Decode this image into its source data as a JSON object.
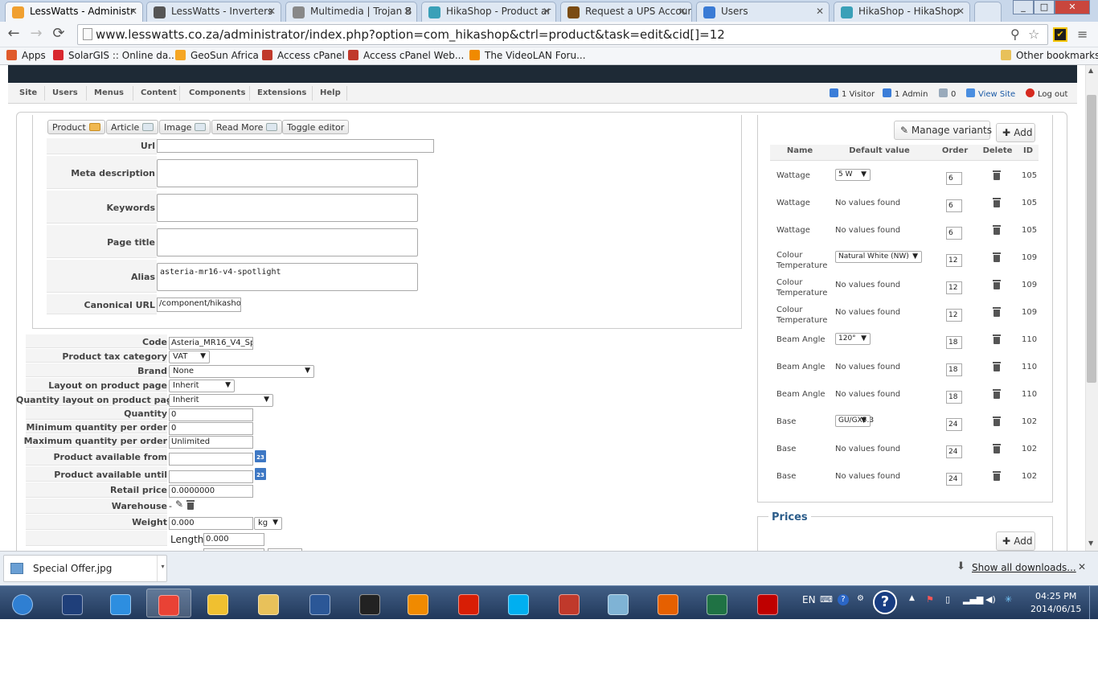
{
  "browser": {
    "tabs": [
      {
        "title": "LessWatts - Administr",
        "icon": "joomla-icon",
        "color": "#f0a030",
        "active": true
      },
      {
        "title": "LessWatts - Inverters",
        "icon": "globe-icon",
        "color": "#555",
        "active": false
      },
      {
        "title": "Multimedia | Trojan B",
        "icon": "document-icon",
        "color": "#888",
        "active": false
      },
      {
        "title": "HikaShop - Product ar",
        "icon": "hikashop-icon",
        "color": "#3aa0b8",
        "active": false
      },
      {
        "title": "Request a UPS Accour",
        "icon": "ups-icon",
        "color": "#7a4b12",
        "active": false
      },
      {
        "title": "Users",
        "icon": "globe-icon",
        "color": "#3a7bd5",
        "active": false
      },
      {
        "title": "HikaShop - HikaShop",
        "icon": "hikashop-icon",
        "color": "#3aa0b8",
        "active": false
      }
    ],
    "url": "www.lesswatts.co.za/administrator/index.php?option=com_hikashop&ctrl=product&task=edit&cid[]=12",
    "window_buttons": [
      "_",
      "□",
      "✕"
    ],
    "bookmarks": [
      {
        "label": "Apps",
        "icon": "apps-icon",
        "color": "#e05a2b"
      },
      {
        "label": "SolarGIS :: Online da...",
        "icon": "solargis-icon",
        "color": "#d8282f"
      },
      {
        "label": "GeoSun Africa",
        "icon": "geosun-icon",
        "color": "#f5a623"
      },
      {
        "label": "Access cPanel",
        "icon": "cpanel-icon",
        "color": "#c0392b"
      },
      {
        "label": "Access cPanel Web...",
        "icon": "cpanel-icon",
        "color": "#c0392b"
      },
      {
        "label": "The VideoLAN Foru...",
        "icon": "vlc-icon",
        "color": "#f08a00"
      },
      {
        "label": "Other bookmarks",
        "icon": "folder-icon",
        "color": "#e8c15a"
      }
    ]
  },
  "admin": {
    "menu": [
      "Site",
      "Users",
      "Menus",
      "Content",
      "Components",
      "Extensions",
      "Help"
    ],
    "status": {
      "visitors": "1 Visitor",
      "admins": "1 Admin",
      "messages": "0",
      "view_site": "View Site",
      "logout": "Log out"
    }
  },
  "editor_buttons": [
    "Product",
    "Article",
    "Image",
    "Read More",
    "Toggle editor"
  ],
  "seo": {
    "url_label": "Url",
    "url_value": "",
    "meta_label": "Meta description",
    "keywords_label": "Keywords",
    "page_title_label": "Page title",
    "alias_label": "Alias",
    "alias_value": "asteria-mr16-v4-spotlight",
    "canonical_label": "Canonical URL",
    "canonical_value": "/component/hikashop/"
  },
  "product": {
    "code_label": "Code",
    "code": "Asteria_MR16_V4_Sp",
    "tax_label": "Product tax category",
    "tax": "VAT",
    "brand_label": "Brand",
    "brand": "None",
    "layout_label": "Layout on product page",
    "layout": "Inherit",
    "qty_layout_label": "Quantity layout on product page",
    "qty_layout": "Inherit",
    "quantity_label": "Quantity",
    "quantity": "0",
    "min_qty_label": "Minimum quantity per order",
    "min_qty": "0",
    "max_qty_label": "Maximum quantity per order",
    "max_qty": "Unlimited",
    "avail_from_label": "Product available from",
    "avail_from": "",
    "avail_until_label": "Product available until",
    "avail_until": "",
    "retail_label": "Retail price",
    "retail": "0.0000000",
    "warehouse_label": "Warehouse",
    "warehouse": "-",
    "weight_label": "Weight",
    "weight": "0.000",
    "weight_unit": "kg",
    "length_label": "Length",
    "length": "0.000",
    "calendar_text": "23"
  },
  "variants": {
    "manage_label": "Manage variants",
    "add_label": "Add",
    "headers": [
      "Name",
      "Default value",
      "Order",
      "Delete",
      "ID"
    ],
    "rows": [
      {
        "name": "Wattage",
        "value": "5 W",
        "select": true,
        "order": "6",
        "id": "105"
      },
      {
        "name": "Wattage",
        "value": "No values found",
        "select": false,
        "order": "6",
        "id": "105"
      },
      {
        "name": "Wattage",
        "value": "No values found",
        "select": false,
        "order": "6",
        "id": "105"
      },
      {
        "name": "Colour Temperature",
        "value": "Natural White (NW)",
        "select": true,
        "order": "12",
        "id": "109"
      },
      {
        "name": "Colour Temperature",
        "value": "No values found",
        "select": false,
        "order": "12",
        "id": "109"
      },
      {
        "name": "Colour Temperature",
        "value": "No values found",
        "select": false,
        "order": "12",
        "id": "109"
      },
      {
        "name": "Beam Angle",
        "value": "120°",
        "select": true,
        "order": "18",
        "id": "110"
      },
      {
        "name": "Beam Angle",
        "value": "No values found",
        "select": false,
        "order": "18",
        "id": "110"
      },
      {
        "name": "Beam Angle",
        "value": "No values found",
        "select": false,
        "order": "18",
        "id": "110"
      },
      {
        "name": "Base",
        "value": "GU/GX5.3",
        "select": true,
        "order": "24",
        "id": "102"
      },
      {
        "name": "Base",
        "value": "No values found",
        "select": false,
        "order": "24",
        "id": "102"
      },
      {
        "name": "Base",
        "value": "No values found",
        "select": false,
        "order": "24",
        "id": "102"
      }
    ]
  },
  "prices": {
    "title": "Prices",
    "add_label": "Add"
  },
  "download": {
    "file": "Special Offer.jpg",
    "show_all": "Show all downloads..."
  },
  "taskbar": {
    "apps": [
      {
        "icon": "start-orb-icon",
        "color": "#2f7fd2"
      },
      {
        "icon": "chart-app-icon",
        "color": "#1f3f7a"
      },
      {
        "icon": "ie-icon",
        "color": "#2d8ee0"
      },
      {
        "icon": "chrome-icon",
        "color": "#e94235"
      },
      {
        "icon": "outlook-icon",
        "color": "#f0c030"
      },
      {
        "icon": "explorer-icon",
        "color": "#e8c15a"
      },
      {
        "icon": "word-icon",
        "color": "#2b5797"
      },
      {
        "icon": "hp-icon",
        "color": "#222"
      },
      {
        "icon": "media-icon",
        "color": "#f08a00"
      },
      {
        "icon": "pdf-icon",
        "color": "#d81e05"
      },
      {
        "icon": "skype-icon",
        "color": "#00aff0"
      },
      {
        "icon": "ccleaner-icon",
        "color": "#c0392b"
      },
      {
        "icon": "notebook-icon",
        "color": "#7fb3d5"
      },
      {
        "icon": "firefox-icon",
        "color": "#e66000"
      },
      {
        "icon": "excel-icon",
        "color": "#1f7244"
      },
      {
        "icon": "filezilla-icon",
        "color": "#bf0000"
      }
    ],
    "lang": "EN",
    "time": "04:25 PM",
    "date": "2014/06/15"
  }
}
